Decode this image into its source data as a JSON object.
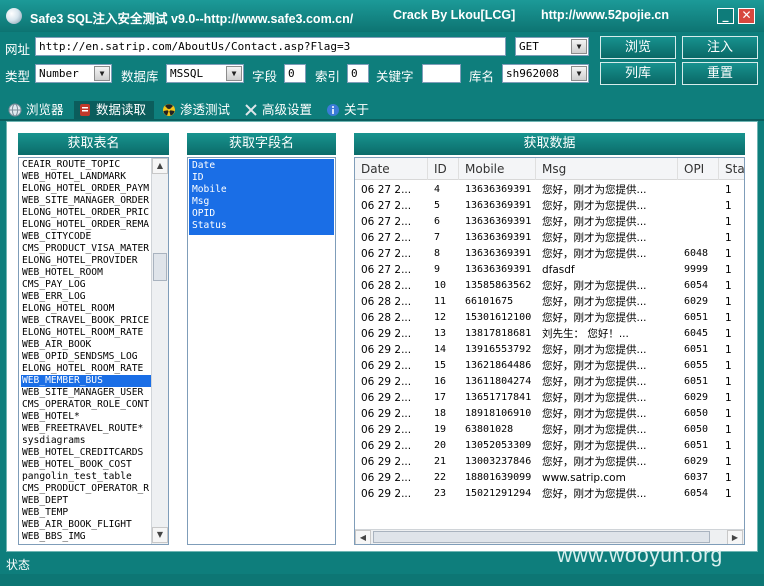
{
  "window": {
    "title_left": "Safe3 SQL注入安全测试 v9.0--http://www.safe3.com.cn/",
    "title_mid": "Crack  By  Lkou[LCG]",
    "title_right": "http://www.52pojie.cn",
    "minimize_glyph": "_",
    "close_glyph": "✕",
    "icon": "app-globe-icon"
  },
  "toolbar": {
    "url_label": "网址",
    "url_value": "http://en.satrip.com/AboutUs/Contact.asp?Flag=3",
    "method_value": "GET",
    "browse_label": "浏览",
    "inject_label": "注入",
    "type_label": "类型",
    "type_value": "Number",
    "db_label": "数据库",
    "db_value": "MSSQL",
    "field_label": "字段",
    "field_value": "0",
    "index_label": "索引",
    "index_value": "0",
    "keyword_label": "关键字",
    "keyword_value": "",
    "dbname_label": "库名",
    "dbname_value": "sh962008",
    "listdb_label": "列库",
    "reset_label": "重置"
  },
  "tabs": [
    {
      "label": "浏览器",
      "icon": "globe-icon",
      "active": false
    },
    {
      "label": "数据读取",
      "icon": "database-icon",
      "active": true
    },
    {
      "label": "渗透测试",
      "icon": "radiation-icon",
      "active": false
    },
    {
      "label": "高级设置",
      "icon": "tools-icon",
      "active": false
    },
    {
      "label": "关于",
      "icon": "info-icon",
      "active": false
    }
  ],
  "tables_panel": {
    "header": "获取表名",
    "selected_index": 18,
    "items": [
      "CEAIR_ROUTE_TOPIC",
      "WEB_HOTEL_LANDMARK",
      "ELONG_HOTEL_ORDER_PAYM",
      "WEB_SITE_MANAGER_ORDER",
      "ELONG_HOTEL_ORDER_PRIC",
      "ELONG_HOTEL_ORDER_REMA",
      "WEB_CITYCODE",
      "CMS_PRODUCT_VISA_MATER",
      "ELONG_HOTEL_PROVIDER",
      "WEB_HOTEL_ROOM",
      "CMS_PAY_LOG",
      "WEB_ERR_LOG",
      "ELONG_HOTEL_ROOM",
      "WEB_CTRAVEL_BOOK_PRICE",
      "ELONG_HOTEL_ROOM_RATE",
      "WEB_AIR_BOOK",
      "WEB_OPID_SENDSMS_LOG",
      "ELONG_HOTEL_ROOM_RATE",
      "WEB_MEMBER_BUS",
      "WEB_SITE_MANAGER_USER",
      "CMS_OPERATOR_ROLE_CONT",
      "WEB_HOTEL*",
      "WEB_FREETRAVEL_ROUTE*",
      "sysdiagrams",
      "WEB_HOTEL_CREDITCARDS",
      "WEB_HOTEL_BOOK_COST",
      "pangolin_test_table",
      "CMS_PRODUCT_OPERATOR_R",
      "WEB_DEPT",
      "WEB_TEMP",
      "WEB_AIR_BOOK_FLIGHT",
      "WEB_BBS_IMG"
    ]
  },
  "fields_panel": {
    "header": "获取字段名",
    "items": [
      "Date",
      "ID",
      "Mobile",
      "Msg",
      "OPID",
      "Status"
    ]
  },
  "data_panel": {
    "header": "获取数据",
    "columns": [
      "Date",
      "ID",
      "Mobile",
      "Msg",
      "OPI",
      "Sta"
    ],
    "rows": [
      [
        "06 27 2...",
        "4",
        "13636369391",
        "您好，刚才为您提供...",
        "",
        "1"
      ],
      [
        "06 27 2...",
        "5",
        "13636369391",
        "您好，刚才为您提供...",
        "",
        "1"
      ],
      [
        "06 27 2...",
        "6",
        "13636369391",
        "您好，刚才为您提供...",
        "",
        "1"
      ],
      [
        "06 27 2...",
        "7",
        "13636369391",
        "您好，刚才为您提供...",
        "",
        "1"
      ],
      [
        "06 27 2...",
        "8",
        "13636369391",
        "您好，刚才为您提供...",
        "6048",
        "1"
      ],
      [
        "06 27 2...",
        "9",
        "13636369391",
        "dfasdf",
        "9999",
        "1"
      ],
      [
        "06 28 2...",
        "10",
        "13585863562",
        "您好，刚才为您提供...",
        "6054",
        "1"
      ],
      [
        "06 28 2...",
        "11",
        "66101675",
        "您好，刚才为您提供...",
        "6029",
        "1"
      ],
      [
        "06 28 2...",
        "12",
        "15301612100",
        "您好，刚才为您提供...",
        "6051",
        "1"
      ],
      [
        "06 29 2...",
        "13",
        "13817818681",
        "刘先生：  您好！...",
        "6045",
        "1"
      ],
      [
        "06 29 2...",
        "14",
        "13916553792",
        "您好，刚才为您提供...",
        "6051",
        "1"
      ],
      [
        "06 29 2...",
        "15",
        "13621864486",
        "您好，刚才为您提供...",
        "6055",
        "1"
      ],
      [
        "06 29 2...",
        "16",
        "13611804274",
        "您好，刚才为您提供...",
        "6051",
        "1"
      ],
      [
        "06 29 2...",
        "17",
        "13651717841",
        "您好，刚才为您提供...",
        "6029",
        "1"
      ],
      [
        "06 29 2...",
        "18",
        "18918106910",
        "您好，刚才为您提供...",
        "6050",
        "1"
      ],
      [
        "06 29 2...",
        "19",
        "63801028",
        "您好，刚才为您提供...",
        "6050",
        "1"
      ],
      [
        "06 29 2...",
        "20",
        "13052053309",
        "您好，刚才为您提供...",
        "6051",
        "1"
      ],
      [
        "06 29 2...",
        "21",
        "13003237846",
        "您好，刚才为您提供...",
        "6029",
        "1"
      ],
      [
        "06 29 2...",
        "22",
        "18801639099",
        "www.satrip.com",
        "6037",
        "1"
      ],
      [
        "06 29 2...",
        "23",
        "15021291294",
        "您好，刚才为您提供...",
        "6054",
        "1"
      ]
    ]
  },
  "statusbar": {
    "label": "状态"
  },
  "watermark": "www.wooyun.org",
  "colors": {
    "window_bg": "#0e7e7c",
    "header_bg": "#0b6b69",
    "selection": "#1a6ee6",
    "close_button": "#d7483e"
  }
}
